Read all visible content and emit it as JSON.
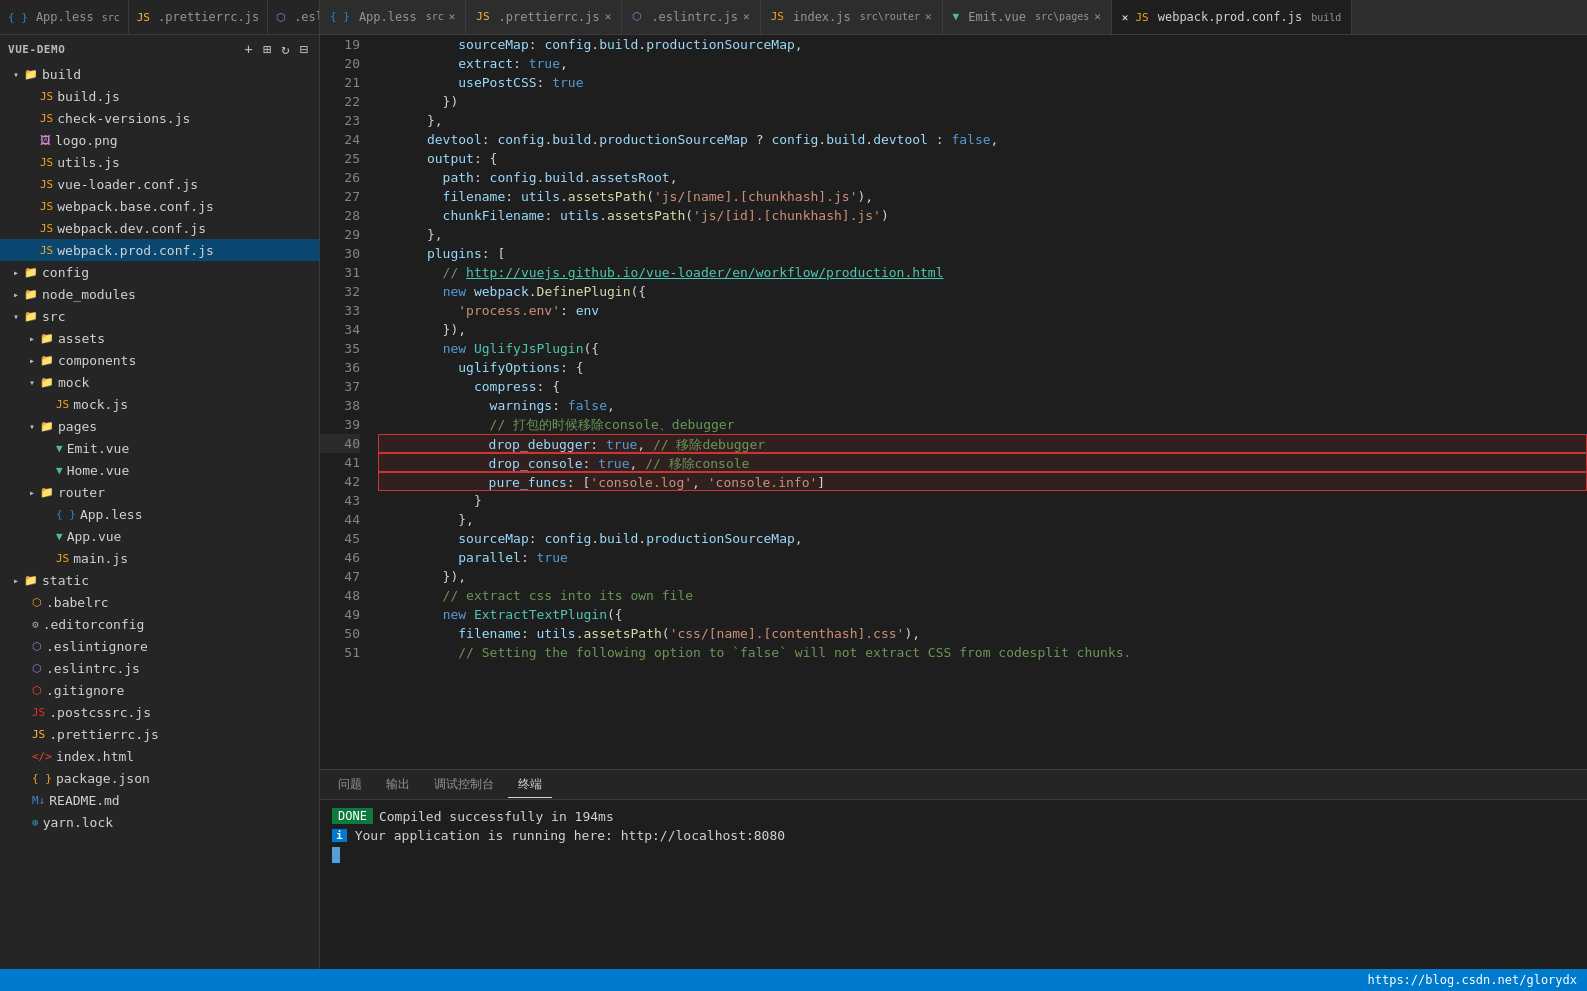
{
  "tabs": {
    "items": [
      {
        "label": "App.less",
        "icon": "less",
        "tag": "src",
        "active": false,
        "modified": false
      },
      {
        "label": ".prettierrc.js",
        "icon": "js",
        "tag": "",
        "active": false,
        "modified": false
      },
      {
        "label": ".eslintrc.js",
        "icon": "eslint",
        "tag": "",
        "active": false,
        "modified": false
      },
      {
        "label": "index.js",
        "icon": "js",
        "tag": "src\\router",
        "active": false,
        "modified": false
      },
      {
        "label": "Emit.vue",
        "icon": "vue",
        "tag": "src\\pages",
        "active": false,
        "modified": false
      },
      {
        "label": "webpack.prod.conf.js",
        "icon": "js",
        "tag": "build",
        "active": true,
        "modified": true
      }
    ]
  },
  "explorer": {
    "title": "VUE-DEMO",
    "tree": [
      {
        "level": 0,
        "type": "folder",
        "open": true,
        "label": "build"
      },
      {
        "level": 1,
        "type": "js",
        "label": "build.js"
      },
      {
        "level": 1,
        "type": "js",
        "label": "check-versions.js"
      },
      {
        "level": 1,
        "type": "png",
        "label": "logo.png"
      },
      {
        "level": 1,
        "type": "js",
        "label": "utils.js"
      },
      {
        "level": 1,
        "type": "js",
        "label": "vue-loader.conf.js"
      },
      {
        "level": 1,
        "type": "js",
        "label": "webpack.base.conf.js"
      },
      {
        "level": 1,
        "type": "js",
        "label": "webpack.dev.conf.js"
      },
      {
        "level": 1,
        "type": "js",
        "label": "webpack.prod.conf.js",
        "selected": true
      },
      {
        "level": 0,
        "type": "folder",
        "open": false,
        "label": "config"
      },
      {
        "level": 0,
        "type": "folder",
        "open": false,
        "label": "node_modules"
      },
      {
        "level": 0,
        "type": "folder",
        "open": true,
        "label": "src"
      },
      {
        "level": 1,
        "type": "folder",
        "open": false,
        "label": "assets"
      },
      {
        "level": 1,
        "type": "folder",
        "open": false,
        "label": "components"
      },
      {
        "level": 1,
        "type": "folder",
        "open": true,
        "label": "mock"
      },
      {
        "level": 2,
        "type": "js",
        "label": "mock.js"
      },
      {
        "level": 1,
        "type": "folder",
        "open": true,
        "label": "pages"
      },
      {
        "level": 2,
        "type": "vue",
        "label": "Emit.vue"
      },
      {
        "level": 2,
        "type": "vue",
        "label": "Home.vue"
      },
      {
        "level": 1,
        "type": "folder",
        "open": false,
        "label": "router"
      },
      {
        "level": 1,
        "type": "less",
        "label": "App.less"
      },
      {
        "level": 1,
        "type": "vue",
        "label": "App.vue"
      },
      {
        "level": 1,
        "type": "js",
        "label": "main.js"
      },
      {
        "level": 0,
        "type": "folder",
        "open": false,
        "label": "static"
      },
      {
        "level": 0,
        "type": "babel",
        "label": ".babelrc"
      },
      {
        "level": 0,
        "type": "editor",
        "label": ".editorconfig"
      },
      {
        "level": 0,
        "type": "eslint",
        "label": ".eslintignore"
      },
      {
        "level": 0,
        "type": "eslint",
        "label": ".eslintrc.js"
      },
      {
        "level": 0,
        "type": "git",
        "label": ".gitignore"
      },
      {
        "level": 0,
        "type": "postcss",
        "label": ".postcssrc.js"
      },
      {
        "level": 0,
        "type": "prettier",
        "label": ".prettierrc.js"
      },
      {
        "level": 0,
        "type": "html",
        "label": "index.html"
      },
      {
        "level": 0,
        "type": "json",
        "label": "package.json"
      },
      {
        "level": 0,
        "type": "md",
        "label": "README.md"
      },
      {
        "level": 0,
        "type": "yarn",
        "label": "yarn.lock"
      }
    ]
  },
  "code": {
    "filename": "webpack.prod.conf.js",
    "tag": "build",
    "lines": [
      {
        "num": 19,
        "content": "          sourceMap: config.build.productionSourceMap,"
      },
      {
        "num": 20,
        "content": "          extract: true,"
      },
      {
        "num": 21,
        "content": "          usePostCSS: true"
      },
      {
        "num": 22,
        "content": "        })"
      },
      {
        "num": 23,
        "content": "      },"
      },
      {
        "num": 24,
        "content": "      devtool: config.build.productionSourceMap ? config.build.devtool : false,"
      },
      {
        "num": 25,
        "content": "      output: {"
      },
      {
        "num": 26,
        "content": "        path: config.build.assetsRoot,"
      },
      {
        "num": 27,
        "content": "        filename: utils.assetsPath('js/[name].[chunkhash].js'),"
      },
      {
        "num": 28,
        "content": "        chunkFilename: utils.assetsPath('js/[id].[chunkhash].js')"
      },
      {
        "num": 29,
        "content": "      },"
      },
      {
        "num": 30,
        "content": "      plugins: ["
      },
      {
        "num": 31,
        "content": "        // http://vuejs.github.io/vue-loader/en/workflow/production.html"
      },
      {
        "num": 32,
        "content": "        new webpack.DefinePlugin({"
      },
      {
        "num": 33,
        "content": "          'process.env': env"
      },
      {
        "num": 34,
        "content": "        }),"
      },
      {
        "num": 35,
        "content": "        new UglifyJsPlugin({"
      },
      {
        "num": 36,
        "content": "          uglifyOptions: {"
      },
      {
        "num": 37,
        "content": "            compress: {"
      },
      {
        "num": 38,
        "content": "              warnings: false,"
      },
      {
        "num": 39,
        "content": "              // 打包的时候移除console、debugger"
      },
      {
        "num": 40,
        "content": "              drop_debugger: true, // 移除debugger",
        "highlight": true
      },
      {
        "num": 41,
        "content": "              drop_console: true, // 移除console",
        "highlight": true
      },
      {
        "num": 42,
        "content": "              pure_funcs: ['console.log', 'console.info']",
        "highlight": true
      },
      {
        "num": 43,
        "content": "            }",
        "highlight": false
      },
      {
        "num": 44,
        "content": "          },"
      },
      {
        "num": 45,
        "content": "          sourceMap: config.build.productionSourceMap,"
      },
      {
        "num": 46,
        "content": "          parallel: true"
      },
      {
        "num": 47,
        "content": "        }),"
      },
      {
        "num": 48,
        "content": "        // extract css into its own file"
      },
      {
        "num": 49,
        "content": "        new ExtractTextPlugin({"
      },
      {
        "num": 50,
        "content": "          filename: utils.assetsPath('css/[name].[contenthash].css'),"
      },
      {
        "num": 51,
        "content": "          // Setting the following option to `false` will not extract CSS from codesplit chunks."
      }
    ]
  },
  "terminal": {
    "tabs": [
      "问题",
      "输出",
      "调试控制台",
      "终端"
    ],
    "active_tab": "终端",
    "done_badge": "DONE",
    "compiled_text": "Compiled successfully in 194ms",
    "running_text": "Your application is running here: http://localhost:8080"
  },
  "status_bar": {
    "url": "https://blog.csdn.net/glorydx"
  }
}
